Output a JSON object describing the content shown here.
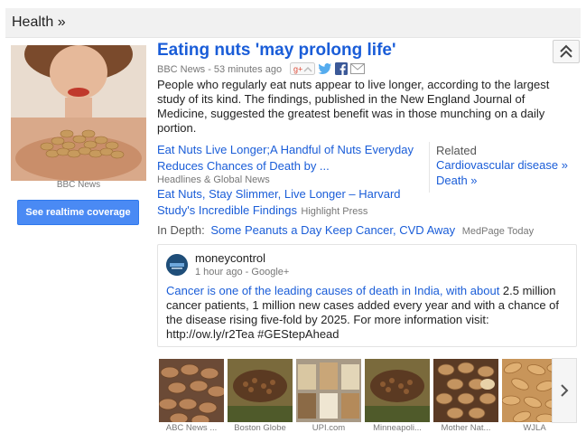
{
  "section": {
    "title": "Health »"
  },
  "lead": {
    "image_caption": "BBC News",
    "realtime_button": "See realtime coverage"
  },
  "story": {
    "headline": "Eating nuts 'may prolong life'",
    "source": "BBC News",
    "separator": "-",
    "time": "53 minutes ago",
    "share_icons": [
      "google-plus-icon",
      "twitter-icon",
      "facebook-icon",
      "email-icon"
    ],
    "snippet": "People who regularly eat nuts appear to live longer, according to the largest study of its kind. The findings, published in the New England Journal of Medicine, suggested the greatest benefit was in those munching on a daily portion."
  },
  "related_articles": [
    {
      "title": "Eat Nuts Live Longer;A Handful of Nuts Everyday Reduces Chances of Death by ...",
      "source": "Headlines & Global News"
    },
    {
      "title": "Eat Nuts, Stay Slimmer, Live Longer – Harvard Study's Incredible Findings",
      "source": "Highlight Press"
    }
  ],
  "related_topics": {
    "heading": "Related",
    "items": [
      "Cardiovascular disease »",
      "Death »"
    ]
  },
  "in_depth": {
    "label": "In Depth:",
    "title": "Some Peanuts a Day Keep Cancer, CVD Away",
    "source": "MedPage Today"
  },
  "social_post": {
    "author": "moneycontrol",
    "time": "1 hour ago",
    "separator": "-",
    "network": "Google+",
    "link_text": "Cancer is one of the leading causes of death in India, with about",
    "text": " 2.5 million cancer patients, 1 million new cases added every year and with a chance of the disease rising five-fold by 2025. For more information visit: http://ow.ly/r2Tea  #GEStepAhead"
  },
  "thumbnails": [
    {
      "caption": "ABC News ..."
    },
    {
      "caption": "Boston Globe"
    },
    {
      "caption": "UPI.com"
    },
    {
      "caption": "Minneapoli..."
    },
    {
      "caption": "Mother Nat..."
    },
    {
      "caption": "WJLA"
    }
  ],
  "colors": {
    "link": "#1a5dd8",
    "button": "#4a8af4",
    "meta": "#777777"
  }
}
